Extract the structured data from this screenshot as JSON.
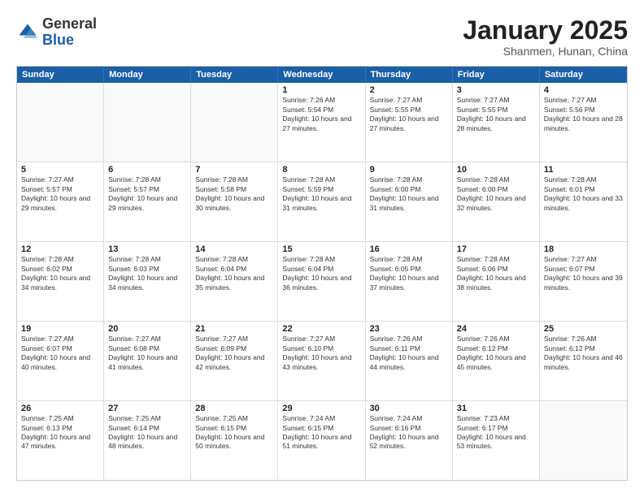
{
  "header": {
    "logo": {
      "general": "General",
      "blue": "Blue"
    },
    "title": "January 2025",
    "subtitle": "Shanmen, Hunan, China"
  },
  "days": [
    "Sunday",
    "Monday",
    "Tuesday",
    "Wednesday",
    "Thursday",
    "Friday",
    "Saturday"
  ],
  "weeks": [
    [
      {
        "num": "",
        "sunrise": "",
        "sunset": "",
        "daylight": "",
        "empty": true
      },
      {
        "num": "",
        "sunrise": "",
        "sunset": "",
        "daylight": "",
        "empty": true
      },
      {
        "num": "",
        "sunrise": "",
        "sunset": "",
        "daylight": "",
        "empty": true
      },
      {
        "num": "1",
        "sunrise": "Sunrise: 7:26 AM",
        "sunset": "Sunset: 5:54 PM",
        "daylight": "Daylight: 10 hours and 27 minutes."
      },
      {
        "num": "2",
        "sunrise": "Sunrise: 7:27 AM",
        "sunset": "Sunset: 5:55 PM",
        "daylight": "Daylight: 10 hours and 27 minutes."
      },
      {
        "num": "3",
        "sunrise": "Sunrise: 7:27 AM",
        "sunset": "Sunset: 5:55 PM",
        "daylight": "Daylight: 10 hours and 28 minutes."
      },
      {
        "num": "4",
        "sunrise": "Sunrise: 7:27 AM",
        "sunset": "Sunset: 5:56 PM",
        "daylight": "Daylight: 10 hours and 28 minutes."
      }
    ],
    [
      {
        "num": "5",
        "sunrise": "Sunrise: 7:27 AM",
        "sunset": "Sunset: 5:57 PM",
        "daylight": "Daylight: 10 hours and 29 minutes."
      },
      {
        "num": "6",
        "sunrise": "Sunrise: 7:28 AM",
        "sunset": "Sunset: 5:57 PM",
        "daylight": "Daylight: 10 hours and 29 minutes."
      },
      {
        "num": "7",
        "sunrise": "Sunrise: 7:28 AM",
        "sunset": "Sunset: 5:58 PM",
        "daylight": "Daylight: 10 hours and 30 minutes."
      },
      {
        "num": "8",
        "sunrise": "Sunrise: 7:28 AM",
        "sunset": "Sunset: 5:59 PM",
        "daylight": "Daylight: 10 hours and 31 minutes."
      },
      {
        "num": "9",
        "sunrise": "Sunrise: 7:28 AM",
        "sunset": "Sunset: 6:00 PM",
        "daylight": "Daylight: 10 hours and 31 minutes."
      },
      {
        "num": "10",
        "sunrise": "Sunrise: 7:28 AM",
        "sunset": "Sunset: 6:00 PM",
        "daylight": "Daylight: 10 hours and 32 minutes."
      },
      {
        "num": "11",
        "sunrise": "Sunrise: 7:28 AM",
        "sunset": "Sunset: 6:01 PM",
        "daylight": "Daylight: 10 hours and 33 minutes."
      }
    ],
    [
      {
        "num": "12",
        "sunrise": "Sunrise: 7:28 AM",
        "sunset": "Sunset: 6:02 PM",
        "daylight": "Daylight: 10 hours and 34 minutes."
      },
      {
        "num": "13",
        "sunrise": "Sunrise: 7:28 AM",
        "sunset": "Sunset: 6:03 PM",
        "daylight": "Daylight: 10 hours and 34 minutes."
      },
      {
        "num": "14",
        "sunrise": "Sunrise: 7:28 AM",
        "sunset": "Sunset: 6:04 PM",
        "daylight": "Daylight: 10 hours and 35 minutes."
      },
      {
        "num": "15",
        "sunrise": "Sunrise: 7:28 AM",
        "sunset": "Sunset: 6:04 PM",
        "daylight": "Daylight: 10 hours and 36 minutes."
      },
      {
        "num": "16",
        "sunrise": "Sunrise: 7:28 AM",
        "sunset": "Sunset: 6:05 PM",
        "daylight": "Daylight: 10 hours and 37 minutes."
      },
      {
        "num": "17",
        "sunrise": "Sunrise: 7:28 AM",
        "sunset": "Sunset: 6:06 PM",
        "daylight": "Daylight: 10 hours and 38 minutes."
      },
      {
        "num": "18",
        "sunrise": "Sunrise: 7:27 AM",
        "sunset": "Sunset: 6:07 PM",
        "daylight": "Daylight: 10 hours and 39 minutes."
      }
    ],
    [
      {
        "num": "19",
        "sunrise": "Sunrise: 7:27 AM",
        "sunset": "Sunset: 6:07 PM",
        "daylight": "Daylight: 10 hours and 40 minutes."
      },
      {
        "num": "20",
        "sunrise": "Sunrise: 7:27 AM",
        "sunset": "Sunset: 6:08 PM",
        "daylight": "Daylight: 10 hours and 41 minutes."
      },
      {
        "num": "21",
        "sunrise": "Sunrise: 7:27 AM",
        "sunset": "Sunset: 6:09 PM",
        "daylight": "Daylight: 10 hours and 42 minutes."
      },
      {
        "num": "22",
        "sunrise": "Sunrise: 7:27 AM",
        "sunset": "Sunset: 6:10 PM",
        "daylight": "Daylight: 10 hours and 43 minutes."
      },
      {
        "num": "23",
        "sunrise": "Sunrise: 7:26 AM",
        "sunset": "Sunset: 6:11 PM",
        "daylight": "Daylight: 10 hours and 44 minutes."
      },
      {
        "num": "24",
        "sunrise": "Sunrise: 7:26 AM",
        "sunset": "Sunset: 6:12 PM",
        "daylight": "Daylight: 10 hours and 45 minutes."
      },
      {
        "num": "25",
        "sunrise": "Sunrise: 7:26 AM",
        "sunset": "Sunset: 6:12 PM",
        "daylight": "Daylight: 10 hours and 46 minutes."
      }
    ],
    [
      {
        "num": "26",
        "sunrise": "Sunrise: 7:25 AM",
        "sunset": "Sunset: 6:13 PM",
        "daylight": "Daylight: 10 hours and 47 minutes."
      },
      {
        "num": "27",
        "sunrise": "Sunrise: 7:25 AM",
        "sunset": "Sunset: 6:14 PM",
        "daylight": "Daylight: 10 hours and 48 minutes."
      },
      {
        "num": "28",
        "sunrise": "Sunrise: 7:25 AM",
        "sunset": "Sunset: 6:15 PM",
        "daylight": "Daylight: 10 hours and 50 minutes."
      },
      {
        "num": "29",
        "sunrise": "Sunrise: 7:24 AM",
        "sunset": "Sunset: 6:15 PM",
        "daylight": "Daylight: 10 hours and 51 minutes."
      },
      {
        "num": "30",
        "sunrise": "Sunrise: 7:24 AM",
        "sunset": "Sunset: 6:16 PM",
        "daylight": "Daylight: 10 hours and 52 minutes."
      },
      {
        "num": "31",
        "sunrise": "Sunrise: 7:23 AM",
        "sunset": "Sunset: 6:17 PM",
        "daylight": "Daylight: 10 hours and 53 minutes."
      },
      {
        "num": "",
        "sunrise": "",
        "sunset": "",
        "daylight": "",
        "empty": true
      }
    ]
  ]
}
